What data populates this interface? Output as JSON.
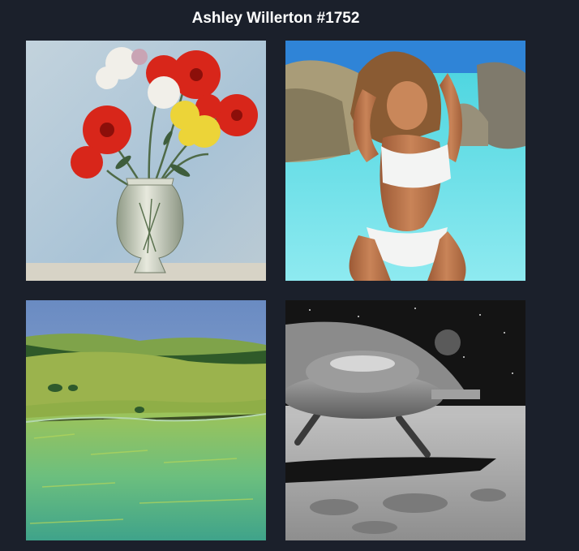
{
  "page": {
    "title": "Ashley Willerton #1752"
  },
  "gallery": {
    "images": [
      {
        "subject": "flowers-in-vase-painting"
      },
      {
        "subject": "woman-in-white-bikini-at-lagoon"
      },
      {
        "subject": "green-meadow-landscape-painting"
      },
      {
        "subject": "lunar-spaceship-landing"
      }
    ]
  },
  "colors": {
    "background": "#1b202b",
    "title_text": "#ffffff"
  }
}
